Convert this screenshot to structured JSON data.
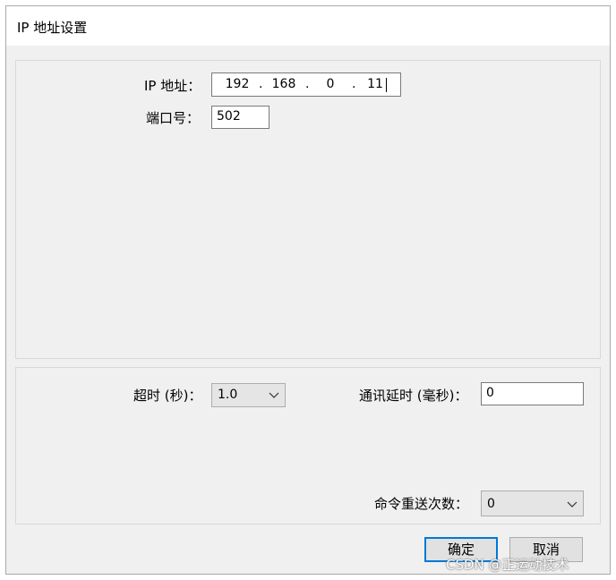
{
  "window": {
    "title": "IP 地址设置"
  },
  "connection": {
    "ip_label": "IP 地址：",
    "ip_segments": [
      "192",
      "168",
      "0",
      "11"
    ],
    "ip_separator": ".",
    "port_label": "端口号：",
    "port_value": "502"
  },
  "comm": {
    "timeout_label": "超时 (秒)：",
    "timeout_value": "1.0",
    "delay_label": "通讯延时 (毫秒)：",
    "delay_value": "0",
    "retry_label": "命令重送次数：",
    "retry_value": "0"
  },
  "buttons": {
    "ok_label": "确定",
    "cancel_label": "取消"
  },
  "watermark": {
    "text": "CSDN @正运动技术"
  },
  "colors": {
    "accent": "#0078d7",
    "dialog_bg": "#f0f0f0"
  }
}
